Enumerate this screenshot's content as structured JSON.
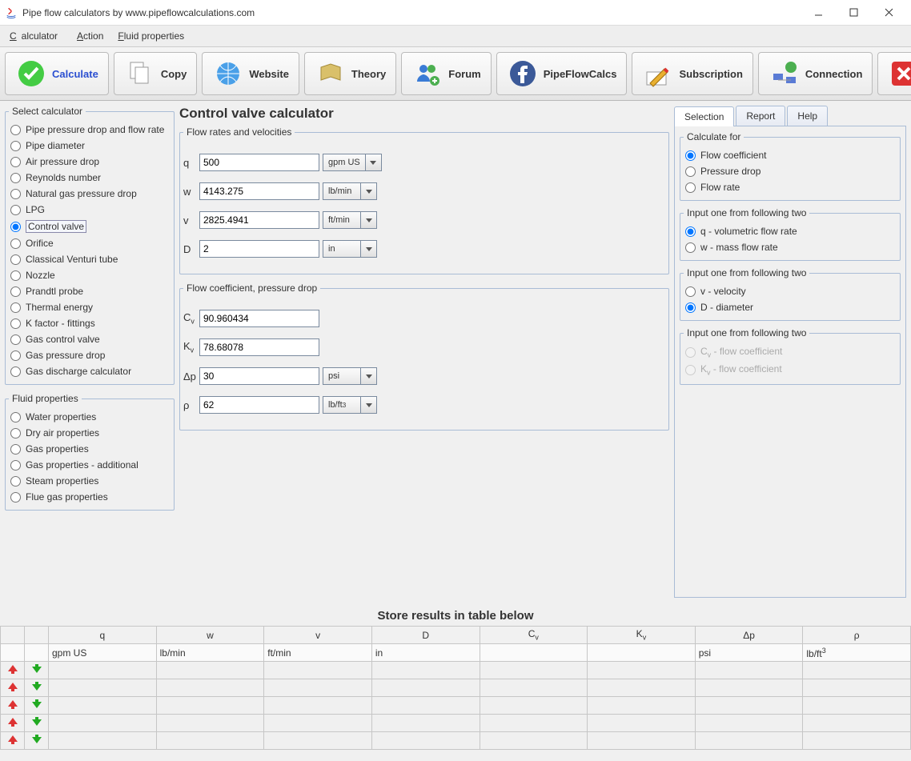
{
  "window": {
    "title": "Pipe flow calculators by www.pipeflowcalculations.com"
  },
  "menubar": {
    "calculator": "Calculator",
    "action": "Action",
    "fluid": "Fluid properties"
  },
  "toolbar": {
    "calculate": "Calculate",
    "copy": "Copy",
    "website": "Website",
    "theory": "Theory",
    "forum": "Forum",
    "pipeflowcalcs": "PipeFlowCalcs",
    "subscription": "Subscription",
    "connection": "Connection",
    "close": "Close"
  },
  "sidebar": {
    "select_calc_legend": "Select calculator",
    "calculators": [
      "Pipe pressure drop and flow rate",
      "Pipe diameter",
      "Air pressure drop",
      "Reynolds number",
      "Natural gas pressure drop",
      "LPG",
      "Control valve",
      "Orifice",
      "Classical Venturi tube",
      "Nozzle",
      "Prandtl probe",
      "Thermal energy",
      "K factor - fittings",
      "Gas control valve",
      "Gas pressure drop",
      "Gas discharge calculator"
    ],
    "selected_calc_index": 6,
    "fluid_legend": "Fluid properties",
    "fluids": [
      "Water properties",
      "Dry air properties",
      "Gas properties",
      "Gas properties - additional",
      "Steam properties",
      "Flue gas properties"
    ]
  },
  "page": {
    "title": "Control valve calculator",
    "section1": "Flow rates and velocities",
    "section2": "Flow coefficient, pressure drop",
    "fields": {
      "q": {
        "sym": "q",
        "value": "500",
        "unit": "gpm US"
      },
      "w": {
        "sym": "w",
        "value": "4143.275",
        "unit": "lb/min"
      },
      "v": {
        "sym": "v",
        "value": "2825.4941",
        "unit": "ft/min"
      },
      "D": {
        "sym": "D",
        "value": "2",
        "unit": "in"
      },
      "Cv": {
        "sym": "C",
        "sub": "v",
        "value": "90.960434"
      },
      "Kv": {
        "sym": "K",
        "sub": "v",
        "value": "78.68078"
      },
      "dp": {
        "sym": "Δp",
        "value": "30",
        "unit": "psi"
      },
      "rho": {
        "sym": "ρ",
        "value": "62",
        "unit": "lb/ft",
        "sup": "3"
      }
    }
  },
  "right": {
    "tabs": [
      "Selection",
      "Report",
      "Help"
    ],
    "calc_for_legend": "Calculate for",
    "calc_for": [
      "Flow coefficient",
      "Pressure drop",
      "Flow rate"
    ],
    "group12_legend": "Input one from following two",
    "group1": [
      "q - volumetric flow rate",
      "w - mass flow rate"
    ],
    "group2": [
      "v - velocity",
      "D - diameter"
    ],
    "group3_legend": "Input one from following two",
    "group3": [
      "C  - flow coefficient",
      "K  - flow coefficient"
    ]
  },
  "table": {
    "title": "Store results in table below",
    "headers": [
      "q",
      "w",
      "v",
      "D",
      "C",
      "K",
      "Δp",
      "ρ"
    ],
    "header_subs": [
      "",
      "",
      "",
      "",
      "v",
      "v",
      "",
      ""
    ],
    "units": [
      "gpm US",
      "lb/min",
      "ft/min",
      "in",
      "",
      "",
      "psi",
      "lb/ft"
    ],
    "unit_sup": [
      "",
      "",
      "",
      "",
      "",
      "",
      "",
      "3"
    ]
  }
}
